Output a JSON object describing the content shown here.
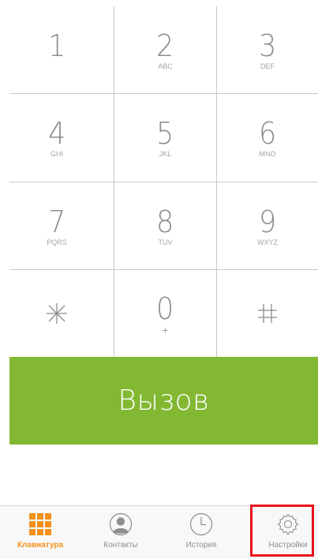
{
  "keypad": {
    "keys": [
      {
        "digit": "1",
        "letters": ""
      },
      {
        "digit": "2",
        "letters": "ABC"
      },
      {
        "digit": "3",
        "letters": "DEF"
      },
      {
        "digit": "4",
        "letters": "GHI"
      },
      {
        "digit": "5",
        "letters": "JKL"
      },
      {
        "digit": "6",
        "letters": "MNO"
      },
      {
        "digit": "7",
        "letters": "PQRS"
      },
      {
        "digit": "8",
        "letters": "TUV"
      },
      {
        "digit": "9",
        "letters": "WXYZ"
      },
      {
        "digit": "0",
        "letters": "+"
      }
    ],
    "star_icon": "asterisk-icon",
    "hash_icon": "hash-icon"
  },
  "call_button": {
    "label": "Вызов",
    "color": "#83b833"
  },
  "tabbar": {
    "active_color": "#f2921b",
    "tabs": [
      {
        "label": "Клавиатура",
        "icon": "keypad-grid-icon",
        "active": true
      },
      {
        "label": "Контакты",
        "icon": "contact-person-icon",
        "active": false
      },
      {
        "label": "История",
        "icon": "clock-icon",
        "active": false
      },
      {
        "label": "Настройки",
        "icon": "gear-icon",
        "active": false
      }
    ]
  },
  "highlight_color": "#e8141c"
}
